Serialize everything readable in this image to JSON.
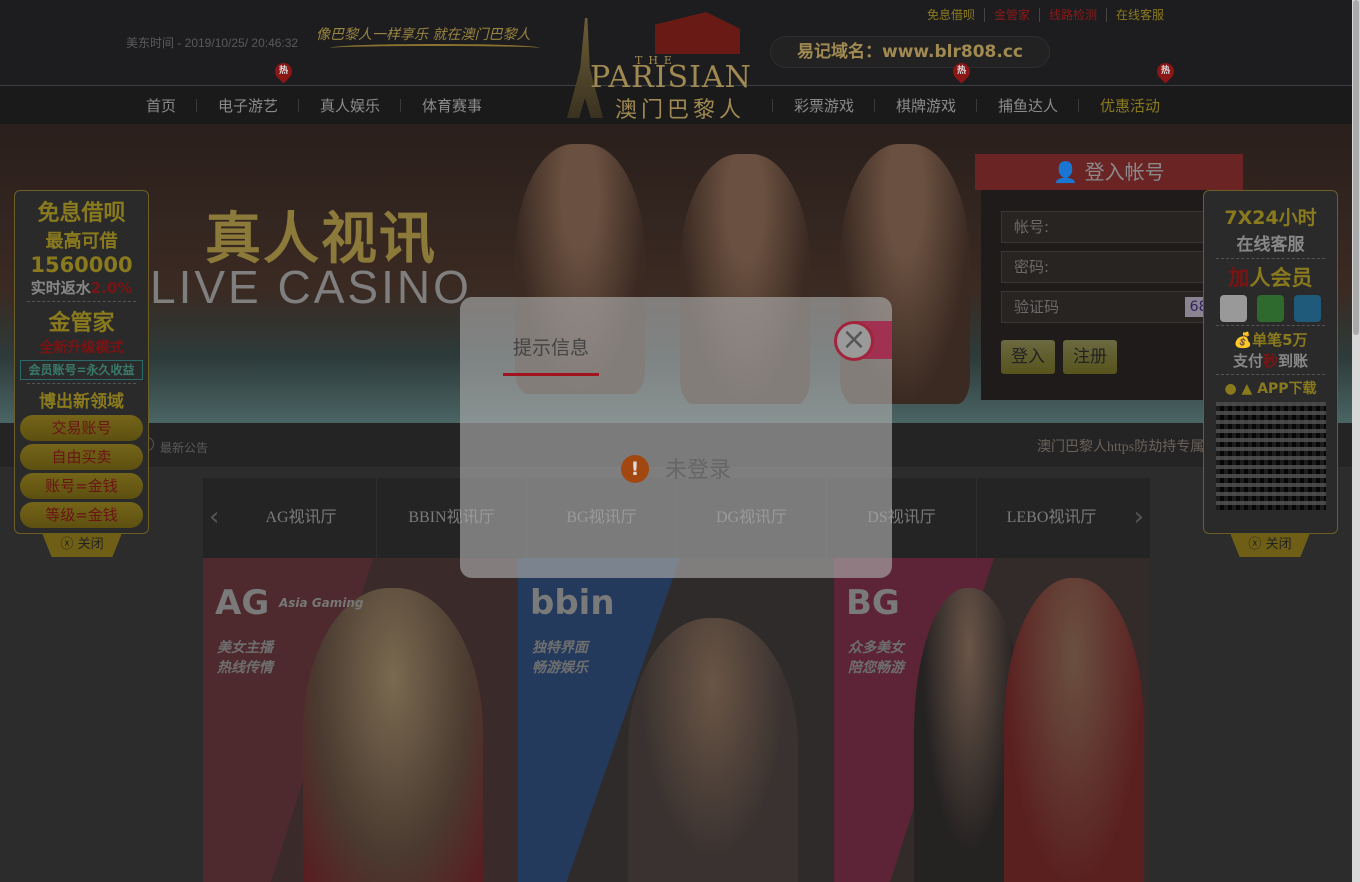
{
  "header": {
    "time_label": "美东时间 - 2019/10/25/ 20:46:32",
    "slogan": "像巴黎人一样享乐 就在澳门巴黎人",
    "top_links": [
      {
        "label": "免息借呗",
        "color": "#8a7a20"
      },
      {
        "label": "金管家",
        "color": "#8a1a1a"
      },
      {
        "label": "线路检测",
        "color": "#8a1a1a"
      },
      {
        "label": "在线客服",
        "color": "#8a7a20"
      }
    ],
    "domain": "易记域名：www.blr808.cc",
    "logo": {
      "the": "THE",
      "name": "PARISIAN",
      "cn": "澳门巴黎人"
    }
  },
  "nav": {
    "items": [
      {
        "label": "首页"
      },
      {
        "label": "电子游艺",
        "hot": true
      },
      {
        "label": "真人娱乐"
      },
      {
        "label": "体育赛事"
      },
      {
        "label": "彩票游戏"
      },
      {
        "label": "棋牌游戏",
        "hot": true
      },
      {
        "label": "捕鱼达人"
      },
      {
        "label": "优惠活动",
        "hot": true,
        "active": true
      }
    ],
    "hot_label": "热"
  },
  "banner": {
    "title_cn": "真人视讯",
    "title_en": "LIVE CASINO"
  },
  "login": {
    "title": "登入帐号",
    "account_placeholder": "帐号:",
    "password_placeholder": "密码:",
    "captcha_placeholder": "验证码",
    "captcha_value": "6806",
    "login_button": "登入",
    "register_button": "注册"
  },
  "notice": {
    "label": "最新公告",
    "message": "澳门巴黎人https防劫持专属"
  },
  "game_tabs": {
    "items": [
      "AG视讯厅",
      "BBIN视讯厅",
      "BG视讯厅",
      "DG视讯厅",
      "DS视讯厅",
      "LEBO视讯厅"
    ]
  },
  "cards": [
    {
      "brand": "AG",
      "brand_sub": "Asia Gaming",
      "text": "美女主播\n热线传情"
    },
    {
      "brand": "bbin",
      "text": "独特界面\n畅游娱乐"
    },
    {
      "brand": "BG",
      "text": "众多美女\n陪您畅游"
    }
  ],
  "left_sidebar": {
    "line1": "免息借呗",
    "line2": "最高可借",
    "amount": "1560000",
    "rebate_label": "实时返水",
    "rebate_value": "2.0%",
    "brand": "金管家",
    "mode": "全新升级模式",
    "member": "会员账号=永久收益",
    "domain": "博出新领域",
    "buttons": [
      "交易账号",
      "自由买卖",
      "账号=金钱",
      "等级=金钱"
    ],
    "close": "关闭"
  },
  "right_sidebar": {
    "service1": "7X24小时",
    "service2": "在线客服",
    "join_a": "加",
    "join_b": "人会员",
    "icons": [
      "qq-icon",
      "wechat-icon",
      "alipay-icon"
    ],
    "single": "单笔5万",
    "pay_a": "支付",
    "pay_b": "秒",
    "pay_c": "到账",
    "app": "APP下载",
    "close": "关闭"
  },
  "modal": {
    "title": "提示信息",
    "message": "未登录"
  }
}
